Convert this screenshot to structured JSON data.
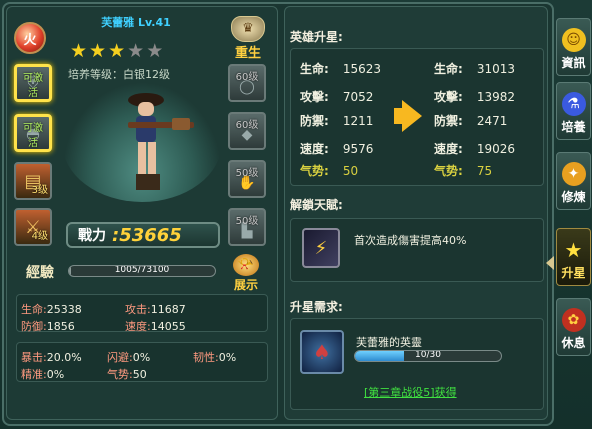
{
  "hero": {
    "name": "芙蕾雅 Lv.41",
    "element_glyph": "火",
    "stars_total": 5,
    "stars_on": 3,
    "training_level": "培养等级：白银12级",
    "rebirth_label": "重生",
    "show_label": "展示",
    "power_label": "戰力",
    "power_value": ":53665",
    "exp_label": "經驗",
    "exp_text": "1005/73100",
    "exp_fraction": 0.0137
  },
  "left_slots": [
    {
      "label": "可激活",
      "highlight": true
    },
    {
      "label": "可激活",
      "highlight": true
    },
    {
      "label": "3级",
      "highlight": false
    },
    {
      "label": "4级",
      "highlight": false
    }
  ],
  "right_slots": [
    {
      "label": "60级"
    },
    {
      "label": "60级"
    },
    {
      "label": "50级"
    },
    {
      "label": "50级"
    }
  ],
  "base_stats": {
    "row1": [
      {
        "k": "生命:",
        "v": "25338"
      },
      {
        "k": "攻击:",
        "v": "11687"
      }
    ],
    "row2": [
      {
        "k": "防御:",
        "v": "1856"
      },
      {
        "k": "速度:",
        "v": "14055"
      }
    ],
    "row3": [
      {
        "k": "暴击:",
        "v": "20.0%"
      },
      {
        "k": "闪避:",
        "v": "0%"
      },
      {
        "k": "韧性:",
        "v": "0%"
      }
    ],
    "row4": [
      {
        "k": "精准:",
        "v": "0%"
      },
      {
        "k": "气势:",
        "v": "50"
      }
    ]
  },
  "upgrade": {
    "title": "英雄升星:",
    "before": [
      {
        "k": "生命:",
        "v": "15623"
      },
      {
        "k": "攻擊:",
        "v": "7052"
      },
      {
        "k": "防禦:",
        "v": "1211"
      },
      {
        "k": "速度:",
        "v": "9576"
      },
      {
        "k": "气势:",
        "v": "50"
      }
    ],
    "after": [
      {
        "k": "生命:",
        "v": "31013"
      },
      {
        "k": "攻擊:",
        "v": "13982"
      },
      {
        "k": "防禦:",
        "v": "2471"
      },
      {
        "k": "速度:",
        "v": "19026"
      },
      {
        "k": "气势:",
        "v": "75"
      }
    ]
  },
  "talent": {
    "title": "解鎖天賦:",
    "text": "首次造成傷害提高40%"
  },
  "requirement": {
    "title": "升星需求:",
    "item_name": "芙蕾雅的英靈",
    "progress_text": "10/30",
    "progress_fraction": 0.3333,
    "link": "[第三章战役5]获得"
  },
  "tabs": [
    {
      "label": "資訊",
      "icon": "helmet-icon",
      "active": false
    },
    {
      "label": "培養",
      "icon": "potion-icon",
      "active": false
    },
    {
      "label": "修煉",
      "icon": "book-icon",
      "active": false
    },
    {
      "label": "升星",
      "icon": "star-icon",
      "active": true
    },
    {
      "label": "休息",
      "icon": "gift-icon",
      "active": false
    }
  ]
}
